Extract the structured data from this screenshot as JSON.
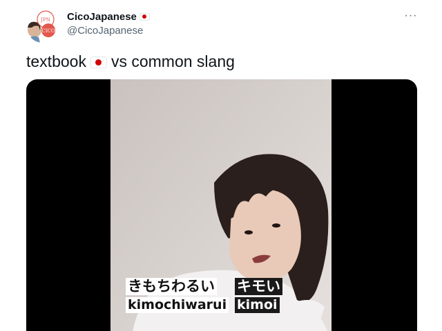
{
  "author": {
    "display_name": "CicoJapanese",
    "display_flag_icon": "japan-flag-icon",
    "handle": "@CicoJapanese",
    "avatar_lines": [
      "JPN",
      "CICO"
    ]
  },
  "more_button": {
    "label": "···",
    "icon": "more-horizontal-icon"
  },
  "tweet": {
    "text_before": "textbook",
    "flag_icon": "japan-flag-icon",
    "text_after": "vs common slang"
  },
  "video": {
    "subtitles": {
      "textbook_kana": "きもちわるい",
      "textbook_romaji": "kimochiwarui",
      "slang_kana": "キモい",
      "slang_romaji": "kimoi"
    }
  },
  "colors": {
    "text_primary": "#0f1419",
    "text_secondary": "#536471",
    "flag_red": "#d30000",
    "avatar_red": "#e2574c",
    "media_background": "#000000"
  }
}
